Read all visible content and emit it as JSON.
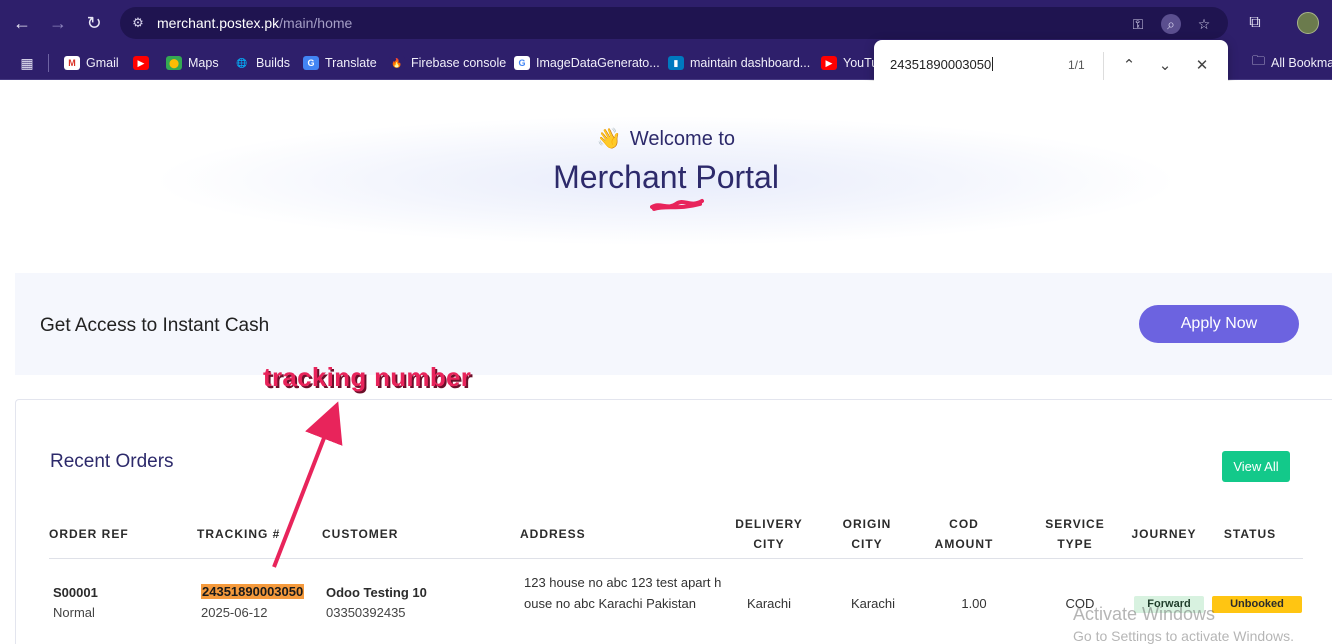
{
  "browser": {
    "url_domain": "merchant.postex.pk",
    "url_path": "/main/home",
    "back_glyph": "←",
    "forward_glyph": "→",
    "reload_glyph": "↻",
    "icons": [
      "back-icon",
      "forward-icon",
      "reload-icon",
      "site-settings-icon",
      "password-key-icon",
      "find-in-page-icon",
      "bookmark-star-icon",
      "extensions-icon",
      "profile-avatar"
    ]
  },
  "bookmarks": [
    {
      "label": "Gmail",
      "icon": "gmail-icon",
      "color": "#ffffff",
      "glyph": "M",
      "glyph_color": "#d93025"
    },
    {
      "label": "",
      "icon": "youtube-icon",
      "color": "#ff0000",
      "glyph": "▶",
      "glyph_color": "#ffffff"
    },
    {
      "label": "Maps",
      "icon": "maps-icon",
      "color": "#34a853",
      "glyph": "⬤",
      "glyph_color": "#fbbc04"
    },
    {
      "label": "Builds",
      "icon": "globe-icon",
      "color": "#2e1f6b",
      "glyph": "🌐",
      "glyph_color": "#e8e6f5"
    },
    {
      "label": "Translate",
      "icon": "translate-icon",
      "color": "#4285f4",
      "glyph": "G",
      "glyph_color": "#ffffff"
    },
    {
      "label": "Firebase console",
      "icon": "firebase-icon",
      "color": "#2e1f6b",
      "glyph": "🔥",
      "glyph_color": "#ffa000"
    },
    {
      "label": "ImageDataGenerato...",
      "icon": "google-icon",
      "color": "#ffffff",
      "glyph": "G",
      "glyph_color": "#4285f4"
    },
    {
      "label": "maintain dashboard...",
      "icon": "trello-icon",
      "color": "#0079bf",
      "glyph": "▮",
      "glyph_color": "#ffffff"
    },
    {
      "label": "YouTu",
      "icon": "youtube-icon",
      "color": "#ff0000",
      "glyph": "▶",
      "glyph_color": "#ffffff"
    }
  ],
  "bookmarks_right": {
    "label": "All Bookma",
    "icon": "folder-icon"
  },
  "findbar": {
    "query": "24351890003050",
    "count": "1/1",
    "prev_glyph": "⌃",
    "next_glyph": "⌄",
    "close_glyph": "✕"
  },
  "hero": {
    "welcome": "Welcome to",
    "wave_glyph": "👋",
    "title": "Merchant Portal"
  },
  "cash": {
    "text": "Get Access to Instant Cash",
    "button": "Apply Now"
  },
  "orders": {
    "title": "Recent Orders",
    "view_all": "View All",
    "columns": {
      "order_ref": "ORDER REF",
      "tracking": "TRACKING #",
      "customer": "CUSTOMER",
      "address": "ADDRESS",
      "delivery_city_1": "DELIVERY",
      "delivery_city_2": "CITY",
      "origin_city_1": "ORIGIN",
      "origin_city_2": "CITY",
      "cod_amount_1": "COD",
      "cod_amount_2": "AMOUNT",
      "service_type_1": "SERVICE",
      "service_type_2": "TYPE",
      "journey": "JOURNEY",
      "status": "STATUS"
    },
    "rows": [
      {
        "order_ref": "S00001",
        "order_type": "Normal",
        "tracking": "24351890003050",
        "date": "2025-06-12",
        "customer": "Odoo Testing 10",
        "phone": "03350392435",
        "address": "123 house no abc 123 test apart house no abc Karachi Pakistan",
        "delivery_city": "Karachi",
        "origin_city": "Karachi",
        "cod_amount": "1.00",
        "service_type": "COD",
        "journey": "Forward",
        "status": "Unbooked"
      }
    ]
  },
  "annotation": {
    "label": "tracking number",
    "color": "#e8245b"
  },
  "watermark": {
    "line1": "Activate Windows",
    "line2": "Go to Settings to activate Windows."
  }
}
